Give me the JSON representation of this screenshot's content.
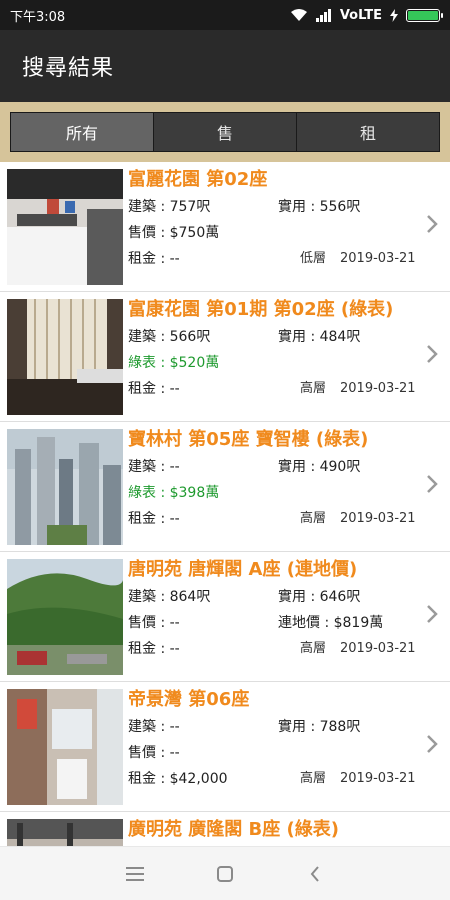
{
  "status": {
    "time": "下午3:08",
    "network": "VoLTE",
    "icons": [
      "wifi-icon",
      "signal-icon",
      "bolt-icon",
      "battery-icon"
    ]
  },
  "appbar": {
    "title": "搜尋結果"
  },
  "tabs": [
    {
      "label": "所有",
      "active": true
    },
    {
      "label": "售",
      "active": false
    },
    {
      "label": "租",
      "active": false
    }
  ],
  "listings": [
    {
      "title": "富麗花園 第02座",
      "area_label": "建築 : 757呎",
      "saleable_label": "實用 : 556呎",
      "price_label": "售價 : $750萬",
      "price_green": false,
      "extra_label": "",
      "rent_label": "租金 : --",
      "floor": "低層",
      "date": "2019-03-21",
      "image": "kitchen"
    },
    {
      "title": "富康花園 第01期 第02座 (綠表)",
      "area_label": "建築 : 566呎",
      "saleable_label": "實用 : 484呎",
      "price_label": "綠表 : $520萬",
      "price_green": true,
      "extra_label": "",
      "rent_label": "租金 : --",
      "floor": "高層",
      "date": "2019-03-21",
      "image": "curtain"
    },
    {
      "title": "寶林村 第05座 寶智樓 (綠表)",
      "area_label": "建築 : --",
      "saleable_label": "實用 : 490呎",
      "price_label": "綠表 : $398萬",
      "price_green": true,
      "extra_label": "",
      "rent_label": "租金 : --",
      "floor": "高層",
      "date": "2019-03-21",
      "image": "towers"
    },
    {
      "title": "唐明苑 唐輝閣 A座 (連地價)",
      "area_label": "建築 : 864呎",
      "saleable_label": "實用 : 646呎",
      "price_label": "售價 : --",
      "price_green": false,
      "extra_label": "連地價 : $819萬",
      "rent_label": "租金 : --",
      "floor": "高層",
      "date": "2019-03-21",
      "image": "hill"
    },
    {
      "title": "帝景灣 第06座",
      "area_label": "建築 : --",
      "saleable_label": "實用 : 788呎",
      "price_label": "售價 : --",
      "price_green": false,
      "extra_label": "",
      "rent_label": "租金 : $42,000",
      "floor": "高層",
      "date": "2019-03-21",
      "image": "bathroom"
    },
    {
      "title": "廣明苑 廣隆閣 B座 (綠表)",
      "area_label": "",
      "saleable_label": "",
      "price_label": "",
      "price_green": false,
      "extra_label": "",
      "rent_label": "",
      "floor": "",
      "date": "",
      "image": "room"
    }
  ],
  "nav": {
    "icons": [
      "menu-icon",
      "home-square-icon",
      "back-chevron-icon"
    ]
  },
  "colors": {
    "title": "#f08a1d",
    "green": "#1f9a2f",
    "appbar": "#2a2a2a",
    "tabs_bg": "#d6c49a"
  }
}
